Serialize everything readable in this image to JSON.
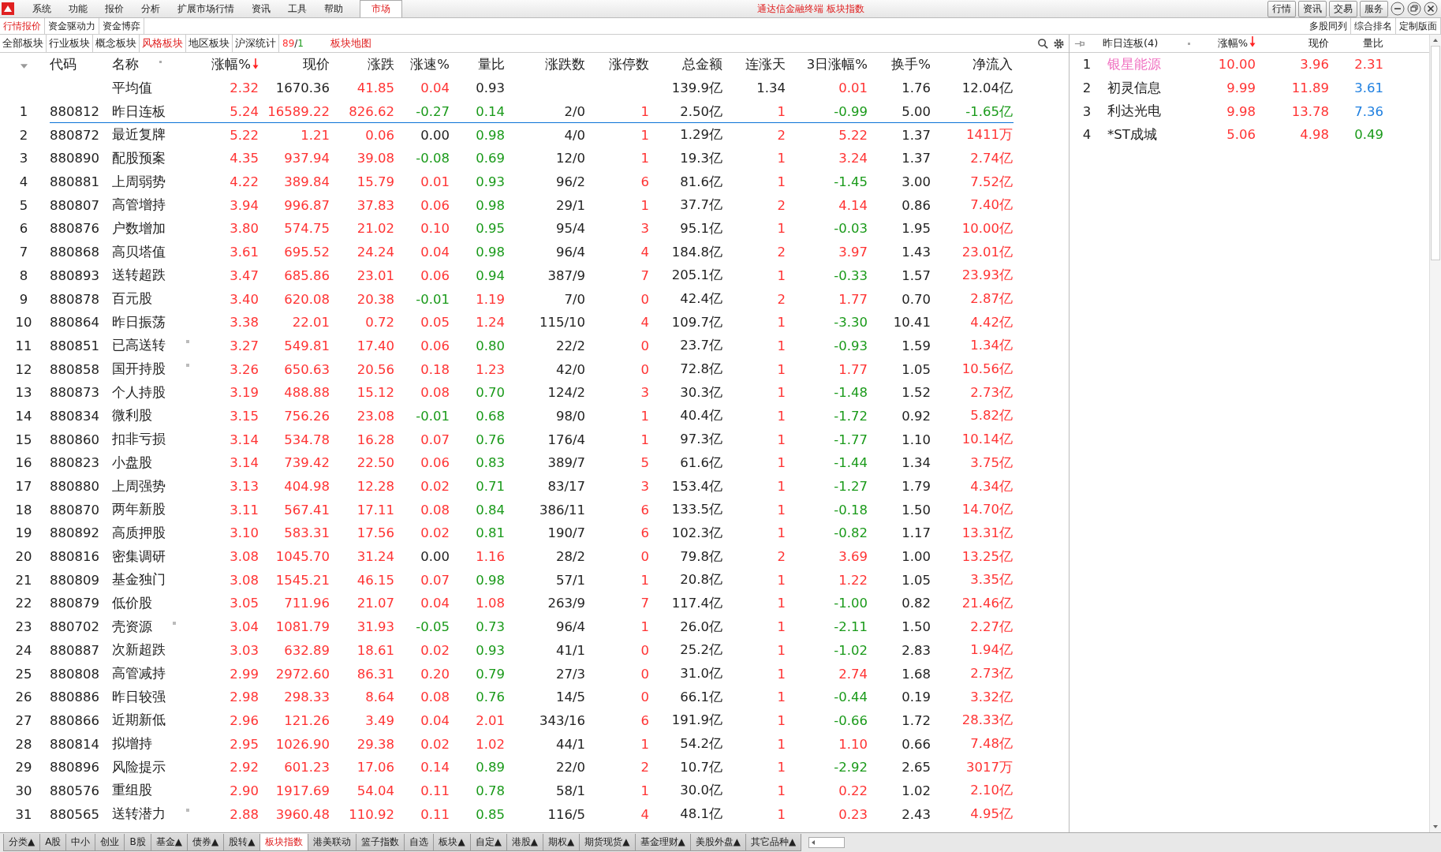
{
  "window": {
    "title": "通达信金融终端 板块指数"
  },
  "menu": [
    {
      "label": "系统",
      "selected": false
    },
    {
      "label": "功能",
      "selected": false
    },
    {
      "label": "报价",
      "selected": false
    },
    {
      "label": "分析",
      "selected": false
    },
    {
      "label": "扩展市场行情",
      "selected": false
    },
    {
      "label": "资讯",
      "selected": false
    },
    {
      "label": "工具",
      "selected": false
    },
    {
      "label": "帮助",
      "selected": false
    },
    {
      "label": "市场",
      "selected": true
    }
  ],
  "top_buttons": [
    "行情",
    "资讯",
    "交易",
    "服务"
  ],
  "view_tabs": [
    {
      "label": "行情报价",
      "selected": true
    },
    {
      "label": "资金驱动力",
      "selected": false
    },
    {
      "label": "资金博弈",
      "selected": false
    }
  ],
  "layout_buttons": [
    "多股同列",
    "综合排名",
    "定制版面"
  ],
  "sector_tabs": [
    {
      "label": "全部板块",
      "selected": false
    },
    {
      "label": "行业板块",
      "selected": false
    },
    {
      "label": "概念板块",
      "selected": false
    },
    {
      "label": "风格板块",
      "selected": true
    },
    {
      "label": "地区板块",
      "selected": false
    },
    {
      "label": "沪深统计",
      "selected": false
    }
  ],
  "breadth": {
    "up": "89",
    "separator": "/",
    "down": "1"
  },
  "map_link": "板块地图",
  "table": {
    "code_header": "代码",
    "name_header": "名称",
    "average_label": "平均值",
    "columns": [
      {
        "label": "涨幅%",
        "kind": "sign",
        "sorted": true,
        "average": {
          "text": "2.32",
          "rising": true
        }
      },
      {
        "label": "现价",
        "kind": "follow",
        "sorted": false,
        "average": {
          "text": "1670.36",
          "rising": false
        }
      },
      {
        "label": "涨跌",
        "kind": "sign",
        "sorted": false,
        "average": {
          "text": "41.85",
          "rising": true
        }
      },
      {
        "label": "涨速%",
        "kind": "sign",
        "sorted": false,
        "average": {
          "text": "0.04",
          "rising": true
        }
      },
      {
        "label": "量比",
        "kind": "ratio",
        "sorted": false,
        "average": {
          "text": "0.93",
          "rising": false
        }
      },
      {
        "label": "涨跌数",
        "kind": "plain",
        "sorted": false
      },
      {
        "label": "涨停数",
        "kind": "up",
        "sorted": false
      },
      {
        "label": "总金额",
        "kind": "plain",
        "sorted": false,
        "average": {
          "text": "139.9亿",
          "rising": false
        }
      },
      {
        "label": "连涨天",
        "kind": "up",
        "sorted": false,
        "average": {
          "text": "1.34",
          "rising": false
        }
      },
      {
        "label": "3日涨幅%",
        "kind": "sign",
        "sorted": false,
        "average": {
          "text": "0.01",
          "rising": true
        }
      },
      {
        "label": "换手%",
        "kind": "plain",
        "sorted": false,
        "average": {
          "text": "1.76",
          "rising": false
        }
      },
      {
        "label": "净流入",
        "kind": "sign",
        "sorted": false,
        "average": {
          "text": "12.04亿",
          "rising": false
        }
      }
    ],
    "rows": [
      {
        "num": "1",
        "code": "880812",
        "name": "昨日连板",
        "marked": false,
        "pinned": true,
        "values": [
          "5.24",
          "16589.22",
          "826.62",
          "-0.27",
          "0.14",
          "2/0",
          "1",
          "2.50亿",
          "1",
          "-0.99",
          "5.00",
          "-1.65亿"
        ]
      },
      {
        "num": "2",
        "code": "880872",
        "name": "最近复牌",
        "marked": false,
        "pinned": false,
        "values": [
          "5.22",
          "1.21",
          "0.06",
          "0.00",
          "0.98",
          "4/0",
          "1",
          "1.29亿",
          "2",
          "5.22",
          "1.37",
          "1411万"
        ]
      },
      {
        "num": "3",
        "code": "880890",
        "name": "配股预案",
        "marked": false,
        "pinned": false,
        "values": [
          "4.35",
          "937.94",
          "39.08",
          "-0.08",
          "0.69",
          "12/0",
          "1",
          "19.3亿",
          "1",
          "3.24",
          "1.37",
          "2.74亿"
        ]
      },
      {
        "num": "4",
        "code": "880881",
        "name": "上周弱势",
        "marked": false,
        "pinned": false,
        "values": [
          "4.22",
          "389.84",
          "15.79",
          "0.01",
          "0.93",
          "96/2",
          "6",
          "81.6亿",
          "1",
          "-1.45",
          "3.00",
          "7.52亿"
        ]
      },
      {
        "num": "5",
        "code": "880807",
        "name": "高管增持",
        "marked": false,
        "pinned": false,
        "values": [
          "3.94",
          "996.87",
          "37.83",
          "0.06",
          "0.98",
          "29/1",
          "1",
          "37.7亿",
          "2",
          "4.14",
          "0.86",
          "7.40亿"
        ]
      },
      {
        "num": "6",
        "code": "880876",
        "name": "户数增加",
        "marked": false,
        "pinned": false,
        "values": [
          "3.80",
          "574.75",
          "21.02",
          "0.10",
          "0.95",
          "95/4",
          "3",
          "95.1亿",
          "1",
          "-0.03",
          "1.95",
          "10.00亿"
        ]
      },
      {
        "num": "7",
        "code": "880868",
        "name": "高贝塔值",
        "marked": false,
        "pinned": false,
        "values": [
          "3.61",
          "695.52",
          "24.24",
          "0.04",
          "0.98",
          "96/4",
          "4",
          "184.8亿",
          "2",
          "3.97",
          "1.43",
          "23.01亿"
        ]
      },
      {
        "num": "8",
        "code": "880893",
        "name": "送转超跌",
        "marked": false,
        "pinned": false,
        "values": [
          "3.47",
          "685.86",
          "23.01",
          "0.06",
          "0.94",
          "387/9",
          "7",
          "205.1亿",
          "1",
          "-0.33",
          "1.57",
          "23.93亿"
        ]
      },
      {
        "num": "9",
        "code": "880878",
        "name": "百元股",
        "marked": false,
        "pinned": false,
        "values": [
          "3.40",
          "620.08",
          "20.38",
          "-0.01",
          "1.19",
          "7/0",
          "0",
          "42.4亿",
          "2",
          "1.77",
          "0.70",
          "2.87亿"
        ]
      },
      {
        "num": "10",
        "code": "880864",
        "name": "昨日振荡",
        "marked": false,
        "pinned": false,
        "values": [
          "3.38",
          "22.01",
          "0.72",
          "0.05",
          "1.24",
          "115/10",
          "4",
          "109.7亿",
          "1",
          "-3.30",
          "10.41",
          "4.42亿"
        ]
      },
      {
        "num": "11",
        "code": "880851",
        "name": "已高送转",
        "marked": true,
        "pinned": false,
        "values": [
          "3.27",
          "549.81",
          "17.40",
          "0.06",
          "0.80",
          "22/2",
          "0",
          "23.7亿",
          "1",
          "-0.93",
          "1.59",
          "1.34亿"
        ]
      },
      {
        "num": "12",
        "code": "880858",
        "name": "国开持股",
        "marked": true,
        "pinned": false,
        "values": [
          "3.26",
          "650.63",
          "20.56",
          "0.18",
          "1.23",
          "42/0",
          "0",
          "72.8亿",
          "1",
          "1.77",
          "1.05",
          "10.56亿"
        ]
      },
      {
        "num": "13",
        "code": "880873",
        "name": "个人持股",
        "marked": false,
        "pinned": false,
        "values": [
          "3.19",
          "488.88",
          "15.12",
          "0.08",
          "0.70",
          "124/2",
          "3",
          "30.3亿",
          "1",
          "-1.48",
          "1.52",
          "2.73亿"
        ]
      },
      {
        "num": "14",
        "code": "880834",
        "name": "微利股",
        "marked": false,
        "pinned": false,
        "values": [
          "3.15",
          "756.26",
          "23.08",
          "-0.01",
          "0.68",
          "98/0",
          "1",
          "40.4亿",
          "1",
          "-1.72",
          "0.92",
          "5.82亿"
        ]
      },
      {
        "num": "15",
        "code": "880860",
        "name": "扣非亏损",
        "marked": false,
        "pinned": false,
        "values": [
          "3.14",
          "534.78",
          "16.28",
          "0.07",
          "0.76",
          "176/4",
          "1",
          "97.3亿",
          "1",
          "-1.77",
          "1.10",
          "10.14亿"
        ]
      },
      {
        "num": "16",
        "code": "880823",
        "name": "小盘股",
        "marked": false,
        "pinned": false,
        "values": [
          "3.14",
          "739.42",
          "22.50",
          "0.06",
          "0.83",
          "389/7",
          "5",
          "61.6亿",
          "1",
          "-1.44",
          "1.34",
          "3.75亿"
        ]
      },
      {
        "num": "17",
        "code": "880880",
        "name": "上周强势",
        "marked": false,
        "pinned": false,
        "values": [
          "3.13",
          "404.98",
          "12.28",
          "0.02",
          "0.71",
          "83/17",
          "3",
          "153.4亿",
          "1",
          "-1.27",
          "1.79",
          "4.34亿"
        ]
      },
      {
        "num": "18",
        "code": "880870",
        "name": "两年新股",
        "marked": false,
        "pinned": false,
        "values": [
          "3.11",
          "567.41",
          "17.11",
          "0.08",
          "0.84",
          "386/11",
          "6",
          "133.5亿",
          "1",
          "-0.18",
          "1.50",
          "14.70亿"
        ]
      },
      {
        "num": "19",
        "code": "880892",
        "name": "高质押股",
        "marked": false,
        "pinned": false,
        "values": [
          "3.10",
          "583.31",
          "17.56",
          "0.02",
          "0.81",
          "190/7",
          "6",
          "102.3亿",
          "1",
          "-0.82",
          "1.17",
          "13.31亿"
        ]
      },
      {
        "num": "20",
        "code": "880816",
        "name": "密集调研",
        "marked": false,
        "pinned": false,
        "values": [
          "3.08",
          "1045.70",
          "31.24",
          "0.00",
          "1.16",
          "28/2",
          "0",
          "79.8亿",
          "2",
          "3.69",
          "1.00",
          "13.25亿"
        ]
      },
      {
        "num": "21",
        "code": "880809",
        "name": "基金独门",
        "marked": false,
        "pinned": false,
        "values": [
          "3.08",
          "1545.21",
          "46.15",
          "0.07",
          "0.98",
          "57/1",
          "1",
          "20.8亿",
          "1",
          "1.22",
          "1.05",
          "3.35亿"
        ]
      },
      {
        "num": "22",
        "code": "880879",
        "name": "低价股",
        "marked": false,
        "pinned": false,
        "values": [
          "3.05",
          "711.96",
          "21.07",
          "0.04",
          "1.08",
          "263/9",
          "7",
          "117.4亿",
          "1",
          "-1.00",
          "0.82",
          "21.46亿"
        ]
      },
      {
        "num": "23",
        "code": "880702",
        "name": "壳资源",
        "marked": true,
        "pinned": false,
        "values": [
          "3.04",
          "1081.79",
          "31.93",
          "-0.05",
          "0.73",
          "96/4",
          "1",
          "26.0亿",
          "1",
          "-2.11",
          "1.50",
          "2.27亿"
        ]
      },
      {
        "num": "24",
        "code": "880887",
        "name": "次新超跌",
        "marked": false,
        "pinned": false,
        "values": [
          "3.03",
          "632.89",
          "18.61",
          "0.02",
          "0.93",
          "41/1",
          "0",
          "25.2亿",
          "1",
          "-1.02",
          "2.83",
          "1.94亿"
        ]
      },
      {
        "num": "25",
        "code": "880808",
        "name": "高管减持",
        "marked": false,
        "pinned": false,
        "values": [
          "2.99",
          "2972.60",
          "86.31",
          "0.20",
          "0.79",
          "27/3",
          "0",
          "31.0亿",
          "1",
          "2.74",
          "1.68",
          "2.73亿"
        ]
      },
      {
        "num": "26",
        "code": "880886",
        "name": "昨日较强",
        "marked": false,
        "pinned": false,
        "values": [
          "2.98",
          "298.33",
          "8.64",
          "0.08",
          "0.76",
          "14/5",
          "0",
          "66.1亿",
          "1",
          "-0.44",
          "0.19",
          "3.32亿"
        ]
      },
      {
        "num": "27",
        "code": "880866",
        "name": "近期新低",
        "marked": false,
        "pinned": false,
        "values": [
          "2.96",
          "121.26",
          "3.49",
          "0.04",
          "2.01",
          "343/16",
          "6",
          "191.9亿",
          "1",
          "-0.66",
          "1.72",
          "28.33亿"
        ]
      },
      {
        "num": "28",
        "code": "880814",
        "name": "拟增持",
        "marked": false,
        "pinned": false,
        "values": [
          "2.95",
          "1026.90",
          "29.38",
          "0.02",
          "1.02",
          "44/1",
          "1",
          "54.2亿",
          "1",
          "1.10",
          "0.66",
          "7.48亿"
        ]
      },
      {
        "num": "29",
        "code": "880896",
        "name": "风险提示",
        "marked": false,
        "pinned": false,
        "values": [
          "2.92",
          "601.23",
          "17.06",
          "0.14",
          "0.89",
          "22/0",
          "2",
          "10.7亿",
          "1",
          "-2.92",
          "2.65",
          "3017万"
        ]
      },
      {
        "num": "30",
        "code": "880576",
        "name": "重组股",
        "marked": false,
        "pinned": false,
        "values": [
          "2.90",
          "1917.69",
          "54.04",
          "0.11",
          "0.78",
          "58/1",
          "1",
          "30.0亿",
          "1",
          "0.22",
          "1.02",
          "2.10亿"
        ]
      },
      {
        "num": "31",
        "code": "880565",
        "name": "送转潜力",
        "marked": true,
        "pinned": false,
        "values": [
          "2.88",
          "3960.48",
          "110.92",
          "0.11",
          "0.85",
          "116/5",
          "4",
          "48.1亿",
          "1",
          "0.23",
          "2.43",
          "4.95亿"
        ]
      }
    ]
  },
  "side_panel": {
    "title": "昨日连板(4)",
    "columns": [
      {
        "label": "涨幅%",
        "sorted": true
      },
      {
        "label": "现价",
        "sorted": false
      },
      {
        "label": "量比",
        "sorted": false
      }
    ],
    "rows": [
      {
        "num": "1",
        "name": "银星能源",
        "highlighted": true,
        "change": "10.00",
        "price": "3.96",
        "ratio": "2.31",
        "color": "#ff3333"
      },
      {
        "num": "2",
        "name": "初灵信息",
        "highlighted": false,
        "change": "9.99",
        "price": "11.89",
        "ratio": "3.61",
        "color": "#1e7fe0"
      },
      {
        "num": "3",
        "name": "利达光电",
        "highlighted": false,
        "change": "9.98",
        "price": "13.78",
        "ratio": "7.36",
        "color": "#1e7fe0"
      },
      {
        "num": "4",
        "name": "*ST成城",
        "highlighted": false,
        "change": "5.06",
        "price": "4.98",
        "ratio": "0.49",
        "color": "#1a9a1a"
      }
    ]
  },
  "bottom_tabs": [
    {
      "label": "分类▲",
      "selected": false
    },
    {
      "label": "A股",
      "selected": false
    },
    {
      "label": "中小",
      "selected": false
    },
    {
      "label": "创业",
      "selected": false
    },
    {
      "label": "B股",
      "selected": false
    },
    {
      "label": "基金▲",
      "selected": false
    },
    {
      "label": "债券▲",
      "selected": false
    },
    {
      "label": "股转▲",
      "selected": false
    },
    {
      "label": "板块指数",
      "selected": true
    },
    {
      "label": "港美联动",
      "selected": false
    },
    {
      "label": "篮子指数",
      "selected": false
    },
    {
      "label": "自选",
      "selected": false
    },
    {
      "label": "板块▲",
      "selected": false
    },
    {
      "label": "自定▲",
      "selected": false
    },
    {
      "label": "港股▲",
      "selected": false
    },
    {
      "label": "期权▲",
      "selected": false
    },
    {
      "label": "期货现货▲",
      "selected": false
    },
    {
      "label": "基金理财▲",
      "selected": false
    },
    {
      "label": "美股外盘▲",
      "selected": false
    },
    {
      "label": "其它品种▲",
      "selected": false
    }
  ]
}
